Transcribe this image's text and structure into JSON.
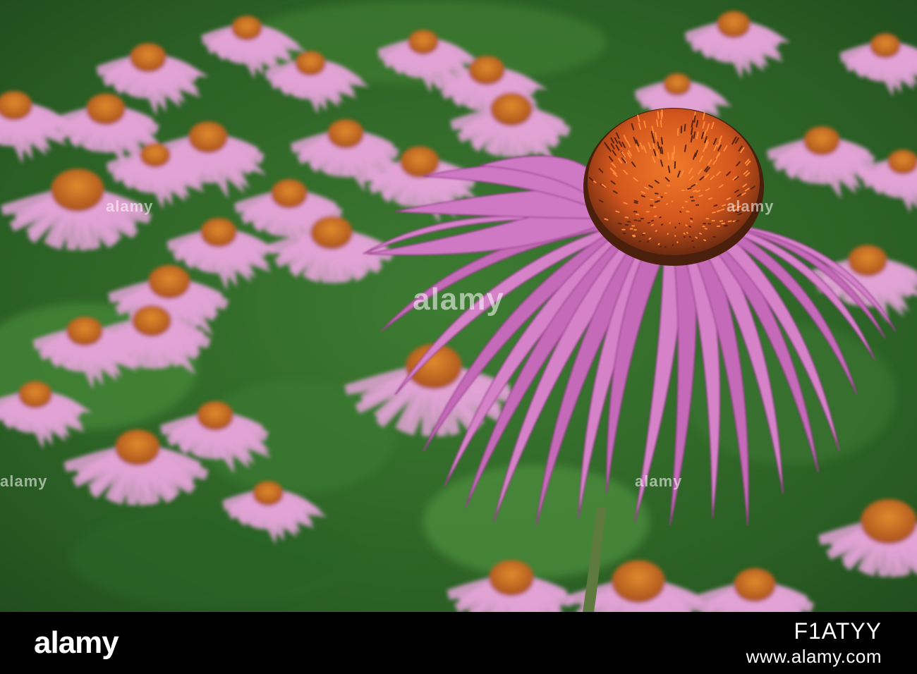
{
  "image": {
    "subject": "purple coneflowers",
    "watermark_logo": "alamy",
    "colors": {
      "foliage": "#2f6b2a",
      "petal": "#c46ab8",
      "cone": "#d4561d",
      "strip": "#000000"
    }
  },
  "footer": {
    "logo_text": "alamy",
    "image_id": "F1ATYY",
    "site": "www.alamy.com"
  },
  "watermarks": {
    "big": "alamy",
    "small": "alamy"
  }
}
